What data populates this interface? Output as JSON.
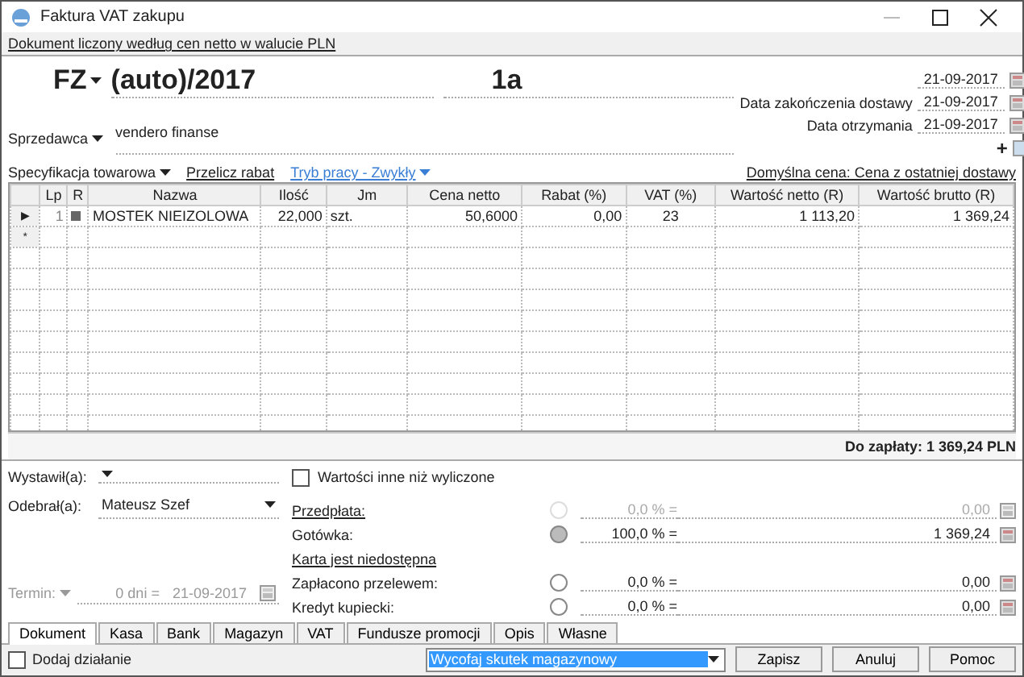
{
  "window": {
    "title": "Faktura VAT zakupu"
  },
  "info_link": "Dokument liczony według cen netto w walucie PLN",
  "document": {
    "type": "FZ",
    "number": "(auto)/2017",
    "suffix": "1a"
  },
  "dates": [
    {
      "value": "21-09-2017"
    },
    {
      "label": "Data zakończenia dostawy",
      "value": "21-09-2017"
    },
    {
      "label": "Data otrzymania",
      "value": "21-09-2017"
    }
  ],
  "seller": {
    "label": "Sprzedawca",
    "value": "vendero finanse",
    "add": "+"
  },
  "spec_bar": {
    "specification": "Specyfikacja towarowa",
    "recalc": "Przelicz rabat",
    "mode": "Tryb pracy - Zwykły",
    "default_price": "Domyślna cena: Cena z ostatniej dostawy"
  },
  "table": {
    "columns": [
      "Lp",
      "R",
      "Nazwa",
      "Ilość",
      "Jm",
      "Cena netto",
      "Rabat (%)",
      "VAT (%)",
      "Wartość netto (R)",
      "Wartość brutto (R)"
    ],
    "rows": [
      {
        "indicator": "▶",
        "cells": [
          "1",
          "",
          "MOSTEK NIEIZOLOWA",
          "22,000",
          "szt.",
          "50,6000",
          "0,00",
          "23",
          "1 113,20",
          "1 369,24"
        ]
      }
    ],
    "new_row_indicator": "*"
  },
  "total": "Do zapłaty: 1 369,24 PLN",
  "issued_by": {
    "label": "Wystawił(a):"
  },
  "received_by": {
    "label": "Odebrał(a):",
    "value": "Mateusz Szef"
  },
  "term": {
    "label": "Termin:",
    "days": "0 dni =",
    "date": "21-09-2017",
    "disabled": true
  },
  "other_values": {
    "label": "Wartości inne niż wyliczone",
    "checked": false
  },
  "payments": [
    {
      "kind": "row",
      "label": "Przedpłata:",
      "link": true,
      "selected": false,
      "disabled": true,
      "percent": "0,0 % =",
      "amount": "0,00"
    },
    {
      "kind": "row",
      "label": "Gotówka:",
      "link": false,
      "selected": true,
      "disabled": false,
      "percent": "100,0 % =",
      "amount": "1 369,24"
    },
    {
      "kind": "note",
      "label": "Karta jest niedostępna",
      "link": true
    },
    {
      "kind": "row",
      "label": "Zapłacono przelewem:",
      "link": false,
      "selected": false,
      "disabled": false,
      "percent": "0,0 % =",
      "amount": "0,00"
    },
    {
      "kind": "row",
      "label": "Kredyt kupiecki:",
      "link": false,
      "selected": false,
      "disabled": false,
      "percent": "0,0 % =",
      "amount": "0,00"
    }
  ],
  "tabs": [
    {
      "label": "Dokument",
      "selected": true
    },
    {
      "label": "Kasa",
      "selected": false
    },
    {
      "label": "Bank",
      "selected": false
    },
    {
      "label": "Magazyn",
      "selected": false
    },
    {
      "label": "VAT",
      "selected": false
    },
    {
      "label": "Fundusze promocji",
      "selected": false
    },
    {
      "label": "Opis",
      "selected": false
    },
    {
      "label": "Własne",
      "selected": false
    }
  ],
  "add_action": {
    "label": "Dodaj działanie",
    "checked": false
  },
  "action_select": {
    "value": "Wycofaj skutek magazynowy"
  },
  "buttons": [
    "Zapisz",
    "Anuluj",
    "Pomoc"
  ]
}
